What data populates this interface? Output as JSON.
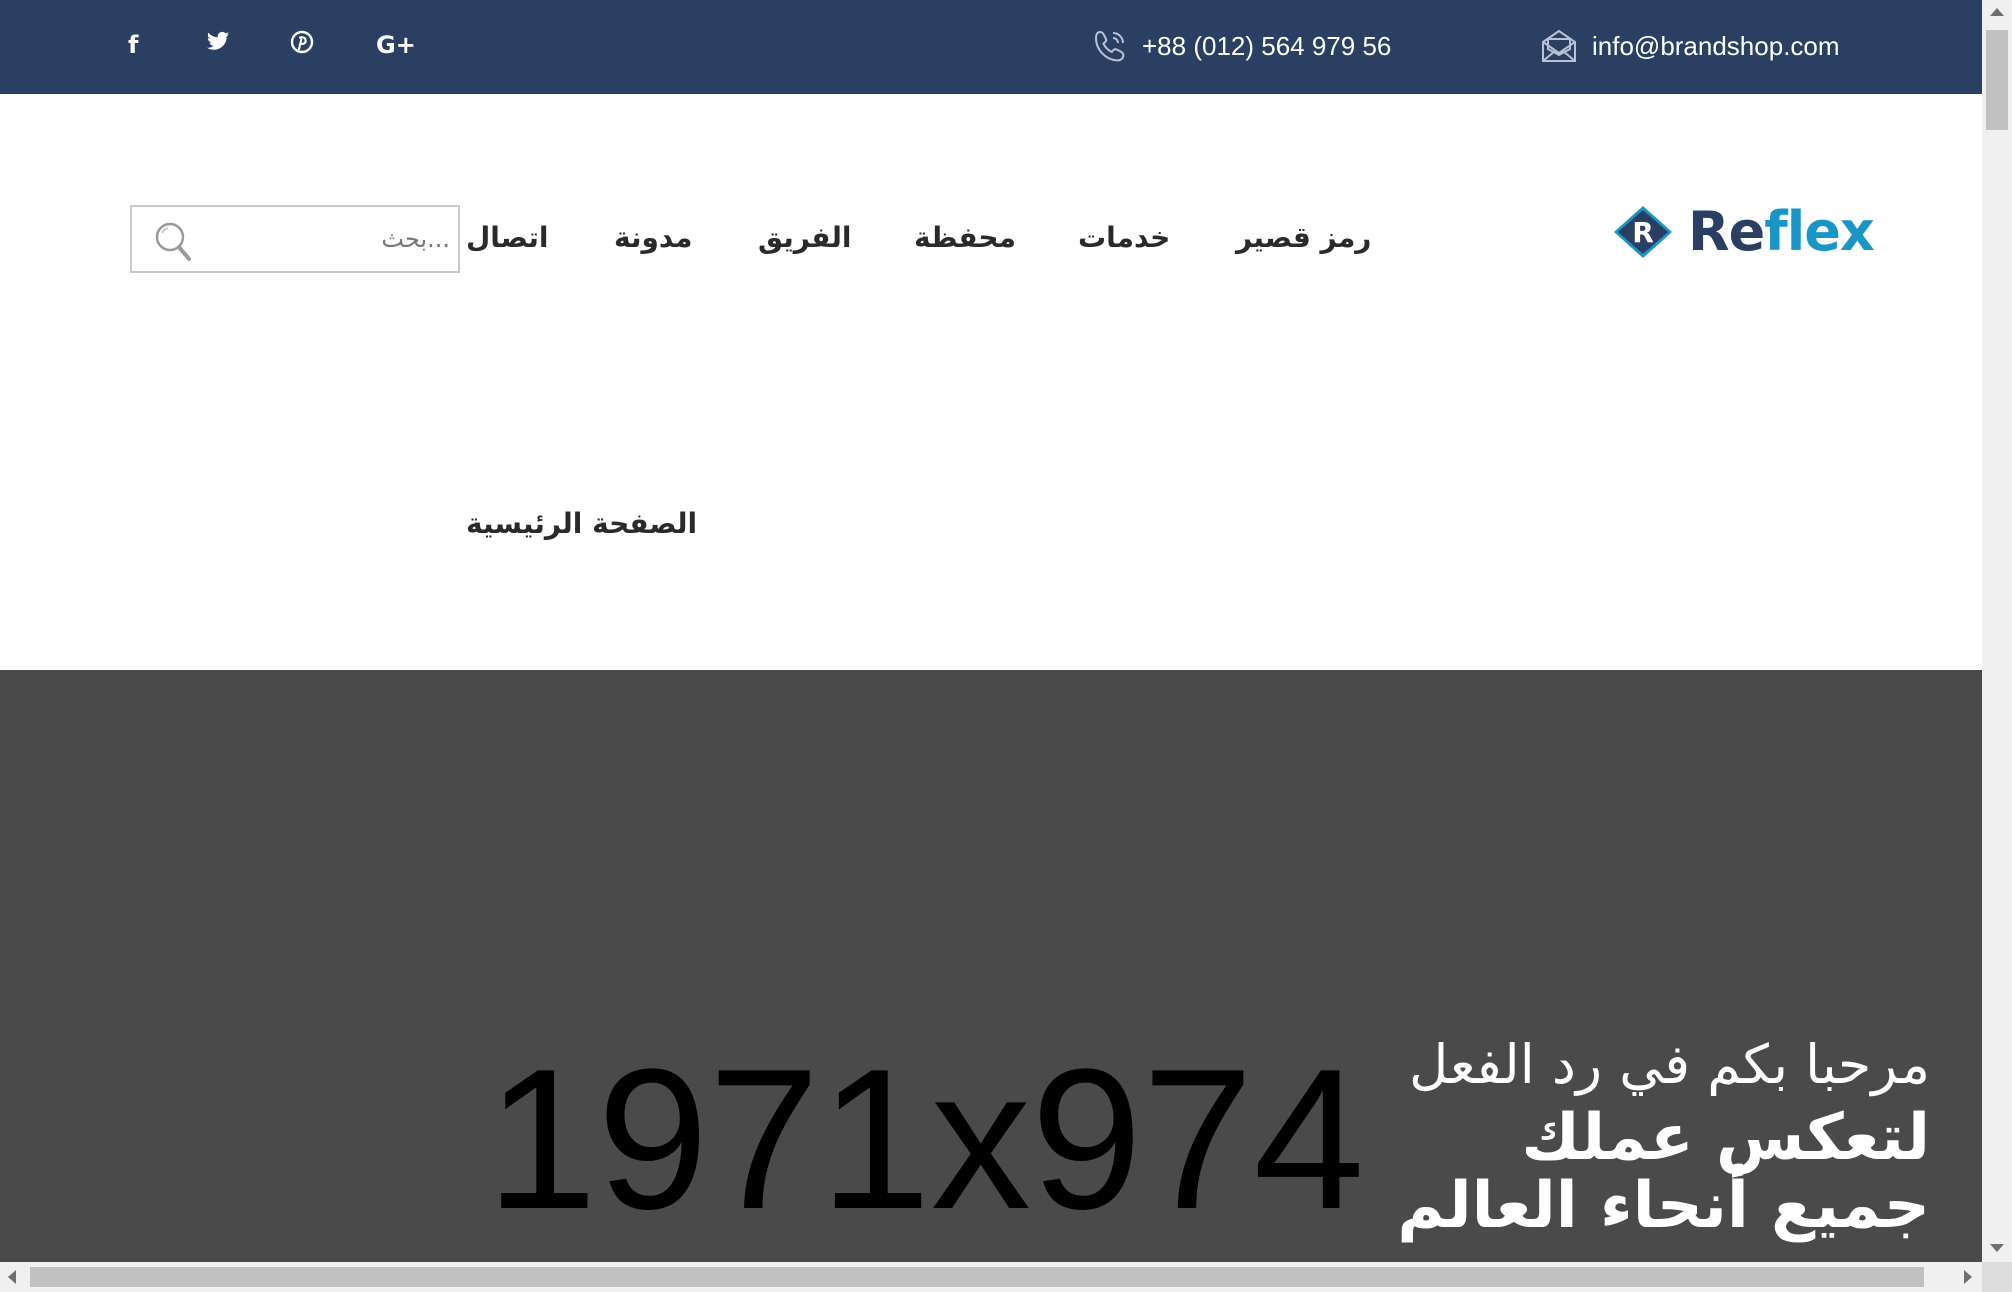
{
  "topbar": {
    "social": [
      {
        "name": "facebook",
        "glyph": "f"
      },
      {
        "name": "twitter",
        "glyph": "🐦"
      },
      {
        "name": "pinterest",
        "glyph": "℗"
      },
      {
        "name": "google-plus",
        "glyph": "G+"
      }
    ],
    "phone": "+88 (012) 564 979 56",
    "email": "info@brandshop.com",
    "background": "#2b3f62"
  },
  "header": {
    "search_placeholder": "...بحث",
    "nav": {
      "shortcode": "رمز قصير",
      "services": "خدمات",
      "portfolio": "محفظة",
      "team": "الفريق",
      "blog": "مدونة",
      "contact": "اتصال",
      "home": "الصفحة الرئيسية"
    },
    "logo": {
      "mark": "R",
      "word_part1": "Re",
      "word_part2": "flex",
      "primary_color": "#2b3f62",
      "accent_color": "#1a96c6"
    }
  },
  "hero": {
    "placeholder_text": "1971x974",
    "line1": "مرحبا بكم في رد الفعل",
    "line2": "لتعكس عملك",
    "line3": "جميع أنحاء العالم",
    "background": "#4a4a4a"
  }
}
